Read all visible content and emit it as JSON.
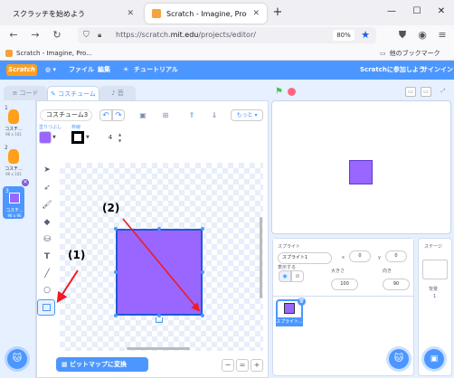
{
  "browser": {
    "tabs": [
      {
        "title": "スクラッチを始めよう",
        "active": false
      },
      {
        "title": "Scratch - Imagine, Program, Share",
        "active": true
      }
    ],
    "new_tab": "+",
    "window_buttons": [
      "—",
      "☐",
      "✕"
    ],
    "url_scheme": "https://scratch.",
    "url_host": "mit.edu",
    "url_path": "/projects/editor/",
    "zoom": "80%",
    "bookmark_item": "Scratch - Imagine, Pro...",
    "other_bookmarks": "他のブックマーク"
  },
  "menubar": {
    "logo": "Scratch",
    "file": "ファイル",
    "edit": "編集",
    "tutorials": "チュートリアル",
    "join": "Scratchに参加しよう",
    "signin": "サインイン"
  },
  "editor_tabs": {
    "code": "コード",
    "costumes": "コスチューム",
    "sounds": "音"
  },
  "costumes": [
    {
      "num": "1",
      "name": "コスチ...",
      "size": "96 x 101"
    },
    {
      "num": "2",
      "name": "コスチ...",
      "size": "96 x 101"
    },
    {
      "num": "3",
      "name": "コスチ...",
      "size": "96 x 96",
      "selected": true
    }
  ],
  "paint": {
    "costume_name": "コスチューム3",
    "more_label": "もっと ▾",
    "fill_label": "塗りつぶし",
    "outline_label": "枠線",
    "fill_color": "#9966ff",
    "outline_color": "#000000",
    "stroke_width": "4",
    "convert_button": "ビットマップに変換",
    "zoom_out": "−",
    "zoom_reset": "=",
    "zoom_in": "+"
  },
  "sprite_info": {
    "label": "スプライト",
    "name": "スプライト1",
    "x_label": "x",
    "x": "0",
    "y_label": "y",
    "y": "0",
    "show_label": "表示する",
    "size_label": "大きさ",
    "size": "100",
    "direction_label": "向き",
    "direction": "90"
  },
  "sprite_tile_name": "スプライト...",
  "stage_panel": {
    "label": "ステージ",
    "backdrops_label": "背景",
    "backdrops_count": "1"
  },
  "annotations": {
    "label1": "(1)",
    "label2": "(2)",
    "arrow_color": "#ee1c24"
  },
  "colors": {
    "scratch_blue": "#4c97ff",
    "shape_fill": "#9966ff"
  }
}
